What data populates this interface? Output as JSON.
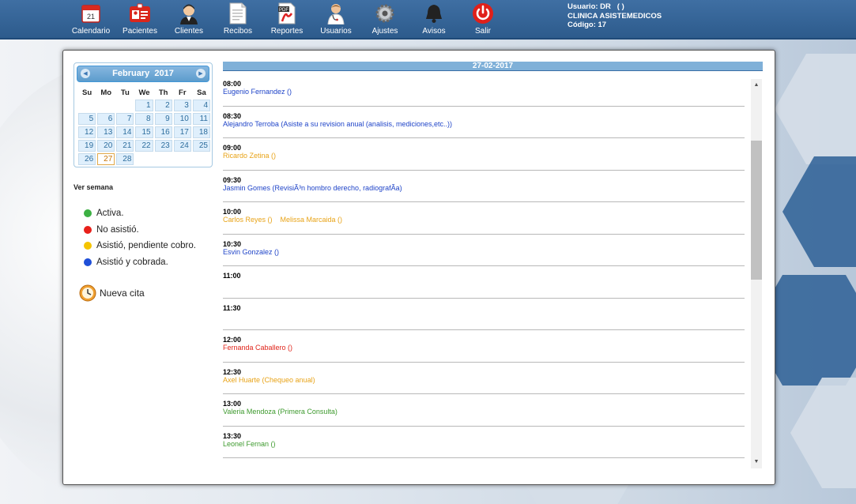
{
  "nav": [
    {
      "label": "Calendario",
      "icon": "calendar-icon"
    },
    {
      "label": "Pacientes",
      "icon": "patient-card-icon"
    },
    {
      "label": "Clientes",
      "icon": "clients-icon"
    },
    {
      "label": "Recibos",
      "icon": "receipts-icon"
    },
    {
      "label": "Reportes",
      "icon": "pdf-report-icon"
    },
    {
      "label": "Usuarios",
      "icon": "doctor-user-icon"
    },
    {
      "label": "Ajustes",
      "icon": "gear-icon"
    },
    {
      "label": "Avisos",
      "icon": "bell-icon"
    },
    {
      "label": "Salir",
      "icon": "power-icon"
    }
  ],
  "user": {
    "line1": "Usuario: DR   ( )",
    "line2": "CLINICA ASISTEMEDICOS",
    "line3": "Código: 17"
  },
  "calendar": {
    "month": "February",
    "year": "2017",
    "weekdays": [
      "Su",
      "Mo",
      "Tu",
      "We",
      "Th",
      "Fr",
      "Sa"
    ],
    "weeks": [
      [
        "",
        "",
        "",
        "1",
        "2",
        "3",
        "4"
      ],
      [
        "5",
        "6",
        "7",
        "8",
        "9",
        "10",
        "11"
      ],
      [
        "12",
        "13",
        "14",
        "15",
        "16",
        "17",
        "18"
      ],
      [
        "19",
        "20",
        "21",
        "22",
        "23",
        "24",
        "25"
      ],
      [
        "26",
        "27",
        "28",
        "",
        "",
        "",
        ""
      ]
    ],
    "today": "27"
  },
  "ver_semana": "Ver semana",
  "legend": [
    {
      "label": "Activa.",
      "color": "#3cb043"
    },
    {
      "label": "No asistió.",
      "color": "#e8201a"
    },
    {
      "label": "Asistió, pendiente cobro.",
      "color": "#f5c400"
    },
    {
      "label": "Asistió y cobrada.",
      "color": "#1f4fd8"
    }
  ],
  "nueva_cita": "Nueva cita",
  "agenda": {
    "date": "27-02-2017",
    "colors": {
      "blue": "#1f44c8",
      "orange": "#e8a317",
      "red": "#e0251b",
      "green": "#3e9a2e"
    },
    "slots": [
      {
        "time": "08:00",
        "appointments": [
          {
            "text": "Eugenio Fernandez ()",
            "status": "blue"
          }
        ]
      },
      {
        "time": "08:30",
        "appointments": [
          {
            "text": "Alejandro Terroba (Asiste a su revision anual (analisis, mediciones,etc..))",
            "status": "blue"
          }
        ]
      },
      {
        "time": "09:00",
        "appointments": [
          {
            "text": "Ricardo Zetina ()",
            "status": "orange"
          }
        ]
      },
      {
        "time": "09:30",
        "appointments": [
          {
            "text": "Jasmin Gomes (RevisiÃ³n hombro derecho, radiografÃa)",
            "status": "blue"
          }
        ]
      },
      {
        "time": "10:00",
        "appointments": [
          {
            "text": "Carlos Reyes ()",
            "status": "orange"
          },
          {
            "text": "Melissa Marcaida ()",
            "status": "orange"
          }
        ]
      },
      {
        "time": "10:30",
        "appointments": [
          {
            "text": "Esvin Gonzalez ()",
            "status": "blue"
          }
        ]
      },
      {
        "time": "11:00",
        "appointments": []
      },
      {
        "time": "11:30",
        "appointments": []
      },
      {
        "time": "12:00",
        "appointments": [
          {
            "text": "Fernanda Caballero ()",
            "status": "red"
          }
        ]
      },
      {
        "time": "12:30",
        "appointments": [
          {
            "text": "Axel Huarte (Chequeo anual)",
            "status": "orange"
          }
        ]
      },
      {
        "time": "13:00",
        "appointments": [
          {
            "text": "Valeria Mendoza (Primera Consulta)",
            "status": "green"
          }
        ]
      },
      {
        "time": "13:30",
        "appointments": [
          {
            "text": "Leonel Fernan ()",
            "status": "green"
          }
        ]
      }
    ]
  }
}
